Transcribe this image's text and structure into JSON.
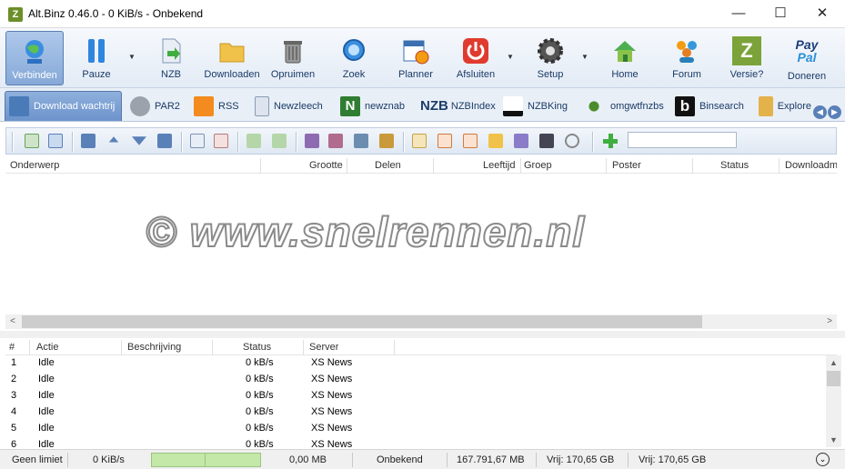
{
  "window": {
    "title": "Alt.Binz 0.46.0 - 0 KiB/s - Onbekend",
    "app_icon": "Z",
    "minimize": "—",
    "maximize": "☐",
    "close": "✕"
  },
  "toolbar": [
    {
      "label": "Verbinden",
      "icon": "globe-icon"
    },
    {
      "label": "Pauze",
      "icon": "pause-icon"
    },
    {
      "label": "NZB",
      "icon": "nzb-file-icon"
    },
    {
      "label": "Downloaden",
      "icon": "folder-icon"
    },
    {
      "label": "Opruimen",
      "icon": "trash-icon"
    },
    {
      "label": "Zoek",
      "icon": "search-icon"
    },
    {
      "label": "Planner",
      "icon": "calendar-icon"
    },
    {
      "label": "Afsluiten",
      "icon": "power-icon"
    },
    {
      "label": "Setup",
      "icon": "gear-icon"
    },
    {
      "label": "Home",
      "icon": "home-icon"
    },
    {
      "label": "Forum",
      "icon": "people-icon"
    },
    {
      "label": "Versie?",
      "icon": "version-icon"
    },
    {
      "label": "Doneren",
      "icon": "paypal-icon"
    }
  ],
  "paypal": {
    "line1": "Pay",
    "line2": "Pal"
  },
  "version_icon_letter": "Z",
  "tabs": [
    {
      "label": "Download wachtrij"
    },
    {
      "label": "PAR2"
    },
    {
      "label": "RSS"
    },
    {
      "label": "Newzleech"
    },
    {
      "label": "newznab"
    },
    {
      "label": "NZBIndex"
    },
    {
      "label": "NZBKing"
    },
    {
      "label": "omgwtfnzbs"
    },
    {
      "label": "Binsearch"
    },
    {
      "label": "Explore"
    }
  ],
  "tab_glyphs": {
    "nzbindex": "NZB",
    "binsearch": "b",
    "newznab": "N"
  },
  "queue_columns": [
    "Onderwerp",
    "Grootte",
    "Delen",
    "Leeftijd",
    "Groep",
    "Poster",
    "Status",
    "Downloadma"
  ],
  "watermark": "© www.snelrennen.nl",
  "connection_columns": [
    "#",
    "Actie",
    "Beschrijving",
    "Status",
    "Server"
  ],
  "connections": [
    {
      "num": "1",
      "action": "Idle",
      "status": "0 kB/s",
      "server": "XS News"
    },
    {
      "num": "2",
      "action": "Idle",
      "status": "0 kB/s",
      "server": "XS News"
    },
    {
      "num": "3",
      "action": "Idle",
      "status": "0 kB/s",
      "server": "XS News"
    },
    {
      "num": "4",
      "action": "Idle",
      "status": "0 kB/s",
      "server": "XS News"
    },
    {
      "num": "5",
      "action": "Idle",
      "status": "0 kB/s",
      "server": "XS News"
    },
    {
      "num": "6",
      "action": "Idle",
      "status": "0 kB/s",
      "server": "XS News"
    }
  ],
  "statusbar": {
    "speed_limit": "Geen limiet",
    "speed": "0 KiB/s",
    "remaining": "0,00 MB",
    "eta": "Onbekend",
    "total": "167.791,67 MB",
    "free1": "Vrij: 170,65 GB",
    "free2": "Vrij: 170,65 GB"
  },
  "scroll_arrows": {
    "left": "<",
    "right": ">",
    "up": "▲",
    "down": "▼"
  },
  "nav_arrows": {
    "prev": "◀",
    "next": "▶"
  },
  "colors": {
    "accent": "#6c93cc",
    "toolbar_text": "#1a3a66",
    "progress": "#c3e8a8"
  }
}
